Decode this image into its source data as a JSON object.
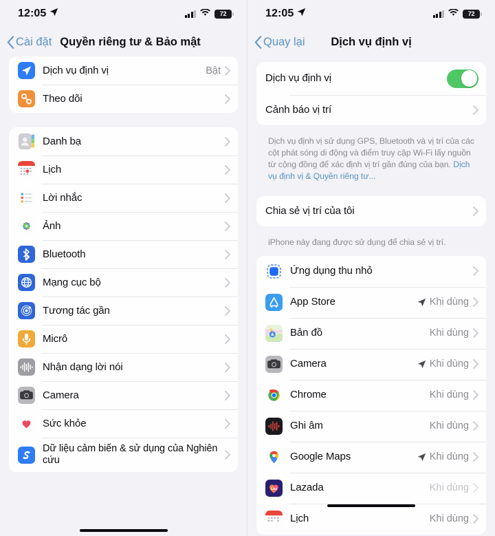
{
  "status_bar": {
    "time": "12:05",
    "location_arrow_icon": "location-arrow-icon",
    "cellular_icon": "cellular-signal-icon",
    "wifi_icon": "wifi-icon",
    "battery_percent": "72"
  },
  "left_panel": {
    "nav": {
      "back_label": "Cài đặt",
      "title": "Quyền riêng tư & Bảo mật",
      "back_icon": "chevron-left-icon"
    },
    "groups": [
      {
        "rows": [
          {
            "icon": "location-services-icon",
            "label": "Dịch vụ định vị",
            "value": "Bật"
          },
          {
            "icon": "tracking-icon",
            "label": "Theo dõi",
            "value": ""
          }
        ]
      },
      {
        "rows": [
          {
            "icon": "contacts-icon",
            "label": "Danh bạ",
            "value": ""
          },
          {
            "icon": "calendar-icon",
            "label": "Lịch",
            "value": ""
          },
          {
            "icon": "reminders-icon",
            "label": "Lời nhắc",
            "value": ""
          },
          {
            "icon": "photos-icon",
            "label": "Ảnh",
            "value": ""
          },
          {
            "icon": "bluetooth-icon",
            "label": "Bluetooth",
            "value": ""
          },
          {
            "icon": "local-network-icon",
            "label": "Mạng cục bộ",
            "value": ""
          },
          {
            "icon": "nearby-interactions-icon",
            "label": "Tương tác gần",
            "value": ""
          },
          {
            "icon": "microphone-icon",
            "label": "Micrô",
            "value": ""
          },
          {
            "icon": "speech-recognition-icon",
            "label": "Nhận dạng lời nói",
            "value": ""
          },
          {
            "icon": "camera-icon",
            "label": "Camera",
            "value": ""
          },
          {
            "icon": "health-icon",
            "label": "Sức khỏe",
            "value": ""
          },
          {
            "icon": "research-sensor-icon",
            "label": "Dữ liệu cảm biến & sử dụng của Nghiên cứu",
            "value": ""
          }
        ]
      }
    ]
  },
  "right_panel": {
    "nav": {
      "back_label": "Quay lại",
      "title": "Dịch vụ định vị",
      "back_icon": "chevron-left-icon"
    },
    "location_services": {
      "toggle_label": "Dịch vụ định vị",
      "toggle_on": true,
      "alerts_label": "Cảnh báo vị trí",
      "footnote_text": "Dịch vụ định vị sử dụng GPS, Bluetooth và vị trí của các cột phát sóng di động và điểm truy cập Wi-Fi lấy nguồn từ cộng đồng để xác định vị trí gần đúng của bạn. ",
      "footnote_link": "Dịch vụ định vị & Quyền riêng tư..."
    },
    "share_location": {
      "label": "Chia sẻ vị trí của tôi",
      "footnote": "iPhone này đang được sử dụng để chia sẻ vị trí."
    },
    "apps": [
      {
        "icon": "app-clips-icon",
        "label": "Ứng dụng thu nhỏ",
        "value": "",
        "arrow": false
      },
      {
        "icon": "app-store-icon",
        "label": "App Store",
        "value": "Khi dùng",
        "arrow": true
      },
      {
        "icon": "maps-icon",
        "label": "Bản đồ",
        "value": "Khi dùng",
        "arrow": false
      },
      {
        "icon": "camera-icon",
        "label": "Camera",
        "value": "Khi dùng",
        "arrow": true
      },
      {
        "icon": "chrome-icon",
        "label": "Chrome",
        "value": "Khi dùng",
        "arrow": false
      },
      {
        "icon": "voice-memos-icon",
        "label": "Ghi âm",
        "value": "Khi dùng",
        "arrow": false
      },
      {
        "icon": "google-maps-icon",
        "label": "Google Maps",
        "value": "Khi dùng",
        "arrow": true
      },
      {
        "icon": "lazada-icon",
        "label": "Lazada",
        "value": "Khi dùng",
        "arrow": false,
        "dim": true
      },
      {
        "icon": "calendar-icon",
        "label": "Lịch",
        "value": "Khi dùng",
        "arrow": false
      }
    ]
  },
  "colors": {
    "accent_blue": "#5a93c4",
    "toggle_green": "#4dc864",
    "background": "#f2f2f7",
    "card": "#fefeff"
  }
}
